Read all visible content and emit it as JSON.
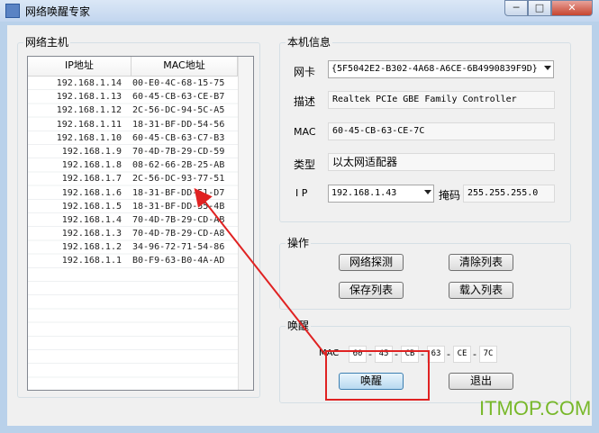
{
  "window": {
    "title": "网络唤醒专家"
  },
  "titlebar_buttons": {
    "minimize": "─",
    "maximize": "□",
    "close": "✕"
  },
  "hosts": {
    "label": "网络主机",
    "columns": [
      "IP地址",
      "MAC地址"
    ],
    "rows": [
      [
        "192.168.1.14",
        "00-E0-4C-68-15-75"
      ],
      [
        "192.168.1.13",
        "60-45-CB-63-CE-B7"
      ],
      [
        "192.168.1.12",
        "2C-56-DC-94-5C-A5"
      ],
      [
        "192.168.1.11",
        "18-31-BF-DD-54-56"
      ],
      [
        "192.168.1.10",
        "60-45-CB-63-C7-B3"
      ],
      [
        "192.168.1.9",
        "70-4D-7B-29-CD-59"
      ],
      [
        "192.168.1.8",
        "08-62-66-2B-25-AB"
      ],
      [
        "192.168.1.7",
        "2C-56-DC-93-77-51"
      ],
      [
        "192.168.1.6",
        "18-31-BF-DD-51-D7"
      ],
      [
        "192.168.1.5",
        "18-31-BF-DD-55-4B"
      ],
      [
        "192.168.1.4",
        "70-4D-7B-29-CD-AB"
      ],
      [
        "192.168.1.3",
        "70-4D-7B-29-CD-A8"
      ],
      [
        "192.168.1.2",
        "34-96-72-71-54-86"
      ],
      [
        "192.168.1.1",
        "B0-F9-63-B0-4A-AD"
      ]
    ]
  },
  "local": {
    "label": "本机信息",
    "nic_label": "网卡",
    "nic_value": "{5F5042E2-B302-4A68-A6CE-6B4990839F9D}",
    "desc_label": "描述",
    "desc_value": "Realtek PCIe GBE Family Controller",
    "mac_label": "MAC",
    "mac_value": "60-45-CB-63-CE-7C",
    "type_label": "类型",
    "type_value": "以太网适配器",
    "ip_label": "I P",
    "ip_value": "192.168.1.43",
    "mask_label": "掩码",
    "mask_value": "255.255.255.0"
  },
  "ops": {
    "label": "操作",
    "scan": "网络探测",
    "clear": "清除列表",
    "save": "保存列表",
    "load": "载入列表"
  },
  "wake": {
    "label": "唤醒",
    "mac_label": "MAC",
    "mac_parts": [
      "60",
      "45",
      "CB",
      "63",
      "CE",
      "7C"
    ],
    "separator": "-",
    "wake_button": "唤醒",
    "exit_button": "退出"
  },
  "watermark": "ITMOP.COM",
  "colors": {
    "annotation": "#e02222",
    "watermark": "#78b82a"
  }
}
